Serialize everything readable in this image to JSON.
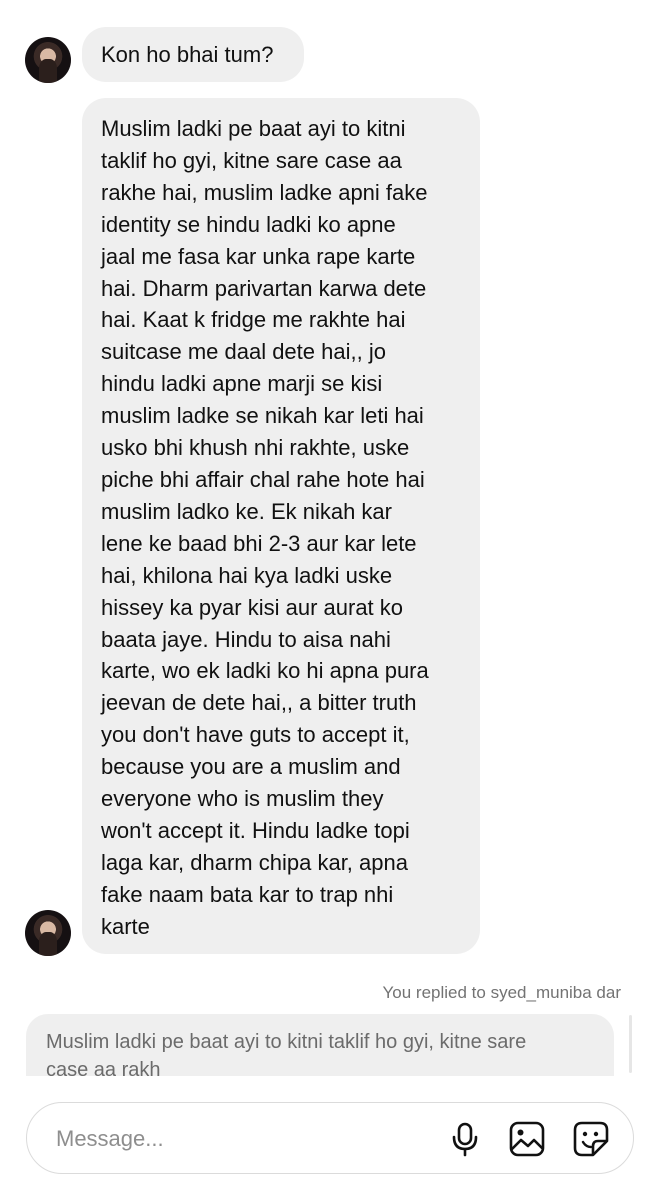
{
  "thread": {
    "messages": [
      {
        "sender": "other",
        "text": "Kon ho bhai tum?"
      },
      {
        "sender": "other",
        "lines": [
          "Muslim ladki pe baat ayi to kitni",
          "taklif ho gyi, kitne sare case aa",
          "rakhe hai, muslim ladke apni fake",
          "identity se hindu ladki ko apne",
          "jaal me fasa kar unka rape karte",
          "hai. Dharm parivartan karwa dete",
          "hai. Kaat k fridge me rakhte hai",
          "suitcase me daal dete hai,, jo",
          "hindu ladki apne marji se kisi",
          "muslim ladke se nikah kar leti hai",
          "usko bhi khush nhi rakhte, uske",
          "piche bhi affair chal rahe hote hai",
          "muslim ladko ke. Ek nikah kar",
          "lene ke baad bhi 2-3 aur kar lete",
          "hai, khilona hai kya ladki uske",
          "hissey ka pyar kisi aur aurat ko",
          "baata jaye. Hindu to aisa nahi",
          "karte, wo ek ladki ko hi apna pura",
          "jeevan de dete hai,, a bitter truth",
          "you don't have guts to accept it,",
          "because you are a muslim and",
          "everyone who is muslim they",
          "won't accept it. Hindu ladke topi",
          "laga kar, dharm chipa kar, apna",
          "fake naam bata kar to trap nhi",
          "karte"
        ]
      }
    ]
  },
  "reply": {
    "caption": "You replied to syed_muniba dar",
    "quote_lines": [
      "Muslim ladki pe baat ayi to kitni taklif ho gyi, kitne sare",
      "case aa rakh"
    ]
  },
  "composer": {
    "placeholder": "Message..."
  },
  "icons": [
    "avatar",
    "microphone-icon",
    "image-icon",
    "sticker-icon"
  ]
}
